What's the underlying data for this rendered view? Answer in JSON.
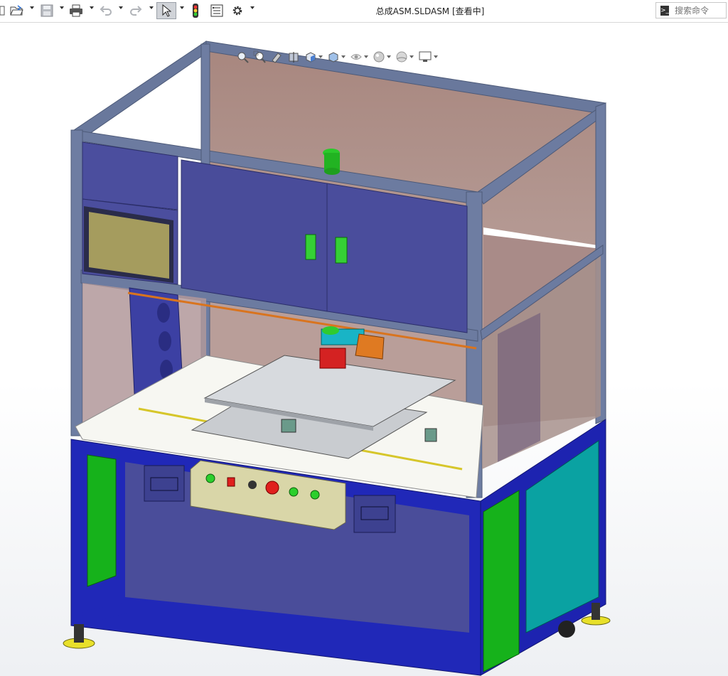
{
  "window": {
    "title": "总成ASM.SLDASM [查看中]"
  },
  "toolbar": {
    "items": [
      {
        "name": "new-document",
        "icon": "new-document-icon"
      },
      {
        "name": "open",
        "icon": "open-folder-icon"
      },
      {
        "name": "save",
        "icon": "save-icon"
      },
      {
        "name": "print",
        "icon": "print-icon"
      },
      {
        "name": "undo",
        "icon": "undo-icon"
      },
      {
        "name": "redo",
        "icon": "redo-icon"
      },
      {
        "name": "select",
        "icon": "select-arrow-icon"
      },
      {
        "name": "rebuild",
        "icon": "traffic-light-icon"
      },
      {
        "name": "file-properties",
        "icon": "file-properties-icon"
      },
      {
        "name": "options",
        "icon": "gear-icon"
      }
    ]
  },
  "search": {
    "placeholder": "搜索命令"
  },
  "headsup_toolbar": {
    "items": [
      {
        "name": "zoom-to-fit",
        "icon": "zoom-fit-icon"
      },
      {
        "name": "zoom-to-area",
        "icon": "zoom-area-icon"
      },
      {
        "name": "previous-view",
        "icon": "previous-view-icon"
      },
      {
        "name": "section-view",
        "icon": "section-view-icon"
      },
      {
        "name": "view-orientation",
        "icon": "view-cube-icon"
      },
      {
        "name": "display-style",
        "icon": "display-style-icon"
      },
      {
        "name": "hide-show-items",
        "icon": "eye-icon"
      },
      {
        "name": "edit-appearance",
        "icon": "appearance-sphere-icon"
      },
      {
        "name": "apply-scene",
        "icon": "scene-icon"
      },
      {
        "name": "view-settings",
        "icon": "monitor-icon"
      }
    ]
  },
  "colors": {
    "frame": "#5a6a8e",
    "panel_blue": "#4a4d9a",
    "enclosure_glass": "#a98a87",
    "base_blue": "#1c22b8",
    "side_green": "#17b21c",
    "side_teal": "#0aa3a3",
    "control_panel": "#d9d6a8",
    "table_top": "#f7f7f2",
    "plate": "#c9ccd0",
    "lamp_green": "#2ccf2c",
    "button_red": "#e0201d",
    "foot_yellow": "#e8e02a"
  }
}
